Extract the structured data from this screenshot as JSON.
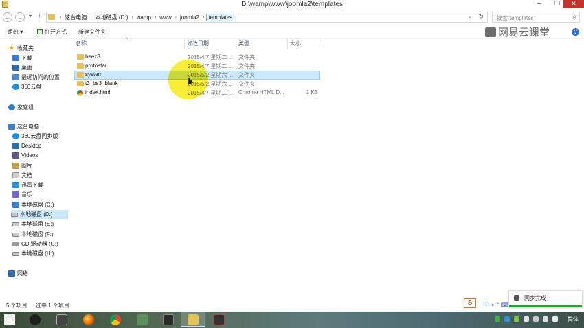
{
  "window": {
    "title": "D:\\wamp\\www\\joomla2\\templates",
    "minimize": "─",
    "restore": "❐",
    "close": "✕"
  },
  "nav": {
    "back": "←",
    "forward": "→",
    "recent": "▾",
    "up": "↑"
  },
  "address": {
    "crumbs": [
      "这台电脑",
      "本地磁盘 (D:)",
      "wamp",
      "www",
      "joomla2",
      "templates"
    ],
    "separator": "›",
    "dropdown": "⌄",
    "refresh": "↻"
  },
  "search": {
    "placeholder": "搜索\"templates\"",
    "icon": "⌕"
  },
  "toolbar": {
    "organize": "组织 ▾",
    "open_with": "打开方式",
    "new_folder": "新建文件夹",
    "help": "?"
  },
  "watermark": "网易云课堂",
  "sidebar": {
    "favorites": "收藏夹",
    "downloads": "下载",
    "desktop": "桌面",
    "recent": "最近访问的位置",
    "cloud360": "360云盘",
    "homegroup": "家庭组",
    "this_pc": "这台电脑",
    "pc_items": [
      "360云盘同步版",
      "Desktop",
      "Videos",
      "图片",
      "文档",
      "迅雷下载",
      "音乐",
      "本地磁盘 (C:)",
      "本地磁盘 (D:)",
      "本地磁盘 (E:)",
      "本地磁盘 (F:)",
      "CD 驱动器 (G:)",
      "本地磁盘 (H:)"
    ],
    "network": "网络"
  },
  "columns": {
    "name": "名称",
    "modified": "修改日期",
    "type": "类型",
    "size": "大小"
  },
  "files": [
    {
      "name": "beez3",
      "modified": "2015/4/7 星期二 ...",
      "type": "文件夹",
      "size": ""
    },
    {
      "name": "protostar",
      "modified": "2015/4/7 星期二 ...",
      "type": "文件夹",
      "size": ""
    },
    {
      "name": "system",
      "modified": "2015/5/2 星期六 ...",
      "type": "文件夹",
      "size": ""
    },
    {
      "name": "t3_bs3_blank",
      "modified": "2015/5/2 星期六 ...",
      "type": "文件夹",
      "size": ""
    },
    {
      "name": "index.html",
      "modified": "2015/4/7 星期二 ...",
      "type": "Chrome HTML D...",
      "size": "1 KB"
    }
  ],
  "status": {
    "item_count": "5 个项目",
    "selected": "选中 1 个项目"
  },
  "toast": {
    "text": "同步完成"
  },
  "ime": {
    "logo": "S",
    "bar": "中 ◗ ° ⌨ ✂"
  },
  "tray": {
    "lang": "简体"
  }
}
